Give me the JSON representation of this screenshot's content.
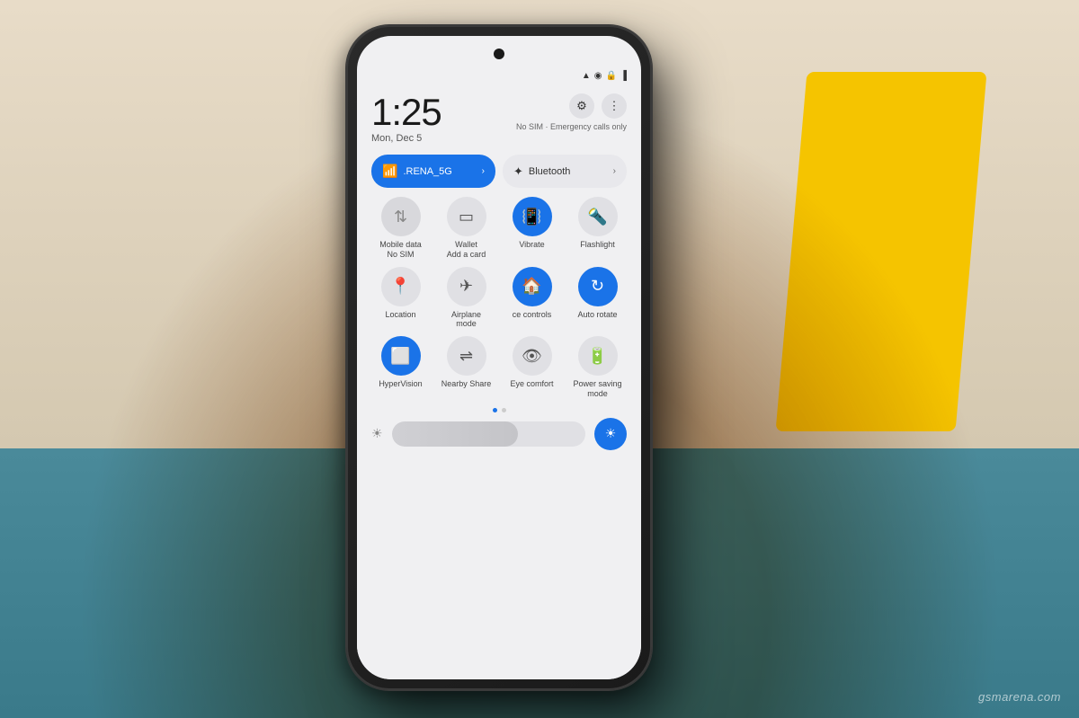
{
  "background": {
    "colors": [
      "#c8b89a",
      "#8a9b6e",
      "#5a7a4a",
      "#e8d080",
      "#f0c040"
    ]
  },
  "phone": {
    "screen": {
      "status_bar": {
        "time": "1:25",
        "date": "Mon, Dec 5",
        "sim_text": "No SIM · Emergency calls only",
        "icons": [
          "wifi",
          "signal",
          "lock",
          "battery"
        ]
      },
      "controls": {
        "settings_icon": "⚙",
        "more_icon": "⋮"
      },
      "wifi_tile": {
        "icon": "📶",
        "label": ".RENA_5G",
        "arrow": "›"
      },
      "bt_tile": {
        "icon": "✦",
        "label": "Bluetooth",
        "arrow": "›"
      },
      "quick_toggles": [
        {
          "icon": "↑↓",
          "label": "Mobile data\nNo SIM",
          "state": "dim"
        },
        {
          "icon": "▬",
          "label": "Wallet\nAdd a card",
          "state": "inactive"
        },
        {
          "icon": "▣",
          "label": "Vibrate",
          "state": "active"
        },
        {
          "icon": "⚡",
          "label": "Flashlight",
          "state": "inactive"
        },
        {
          "icon": "📍",
          "label": "Location",
          "state": "inactive"
        },
        {
          "icon": "✈",
          "label": "Airplane\nmode",
          "state": "inactive"
        },
        {
          "icon": "⊞",
          "label": "ce controls",
          "state": "active"
        },
        {
          "icon": "↻",
          "label": "Auto rotate",
          "state": "active"
        },
        {
          "icon": "□",
          "label": "HyperVision",
          "state": "active"
        },
        {
          "icon": "≈",
          "label": "Nearby Share",
          "state": "inactive"
        },
        {
          "icon": "◎",
          "label": "Eye comfort",
          "state": "inactive"
        },
        {
          "icon": "⊟",
          "label": "Power saving\nmode",
          "state": "inactive"
        }
      ],
      "brightness": {
        "value": 65,
        "sun_icon": "☀"
      }
    }
  },
  "watermark": {
    "text": "gsmarena.com"
  }
}
